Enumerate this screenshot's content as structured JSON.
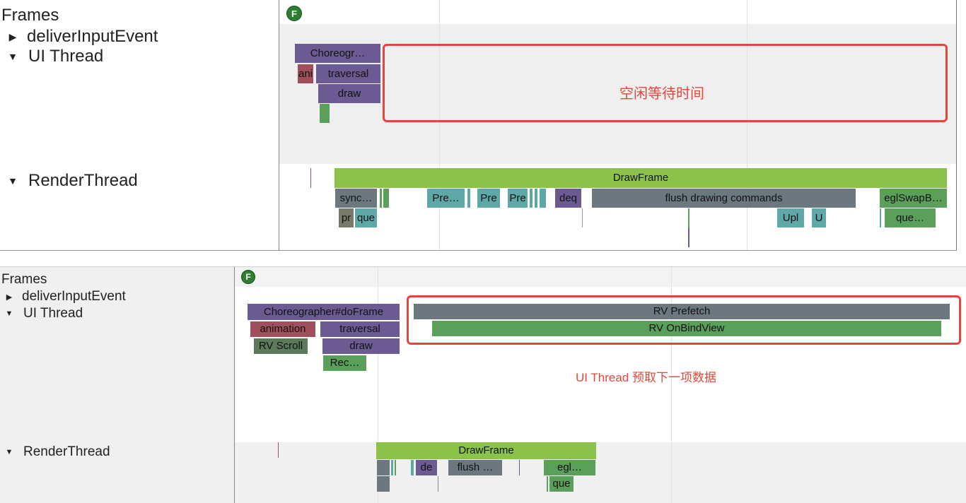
{
  "top": {
    "tracks": {
      "frames": "Frames",
      "deliver_input": "deliverInputEvent",
      "ui_thread": "UI Thread",
      "render_thread": "RenderThread"
    },
    "frame_marker": "F",
    "ui_slices": {
      "choreographer": "Choreogr…",
      "animation": "ani",
      "traversal": "traversal",
      "draw": "draw"
    },
    "render_slices": {
      "drawframe": "DrawFrame",
      "sync": "sync…",
      "pre1": "Pre…",
      "pre2": "Pre",
      "pre3": "Pre",
      "deq": "deq",
      "flush": "flush drawing commands",
      "eglswap": "eglSwapB…",
      "pr": "pr",
      "que": "que",
      "upl": "Upl",
      "u": "U",
      "que2": "que…"
    },
    "annotation": "空闲等待时间"
  },
  "bottom": {
    "tracks": {
      "frames": "Frames",
      "deliver_input": "deliverInputEvent",
      "ui_thread": "UI Thread",
      "render_thread": "RenderThread"
    },
    "frame_marker": "F",
    "ui_slices": {
      "choreographer": "Choreographer#doFrame",
      "animation": "animation",
      "traversal": "traversal",
      "rv_scroll": "RV Scroll",
      "draw": "draw",
      "rec": "Rec…",
      "rv_prefetch": "RV Prefetch",
      "rv_onbindview": "RV OnBindView"
    },
    "render_slices": {
      "drawframe": "DrawFrame",
      "de": "de",
      "flush": "flush …",
      "egl": "egl…",
      "que": "que"
    },
    "annotation": "UI Thread 预取下一项数据"
  },
  "colors": {
    "annotation_red": "#e4463b",
    "slice_purple": "#6c5a93",
    "slice_green": "#5aa05a",
    "slice_lime": "#8bc34a",
    "slice_teal": "#5fa8a8",
    "slice_gray": "#6b7880",
    "slice_red": "#a0505a",
    "marker_green": "#2e7d32"
  },
  "icons": {
    "collapsed": "triangle-right-icon",
    "expanded": "triangle-down-icon",
    "frame_marker": "frame-f-icon"
  }
}
